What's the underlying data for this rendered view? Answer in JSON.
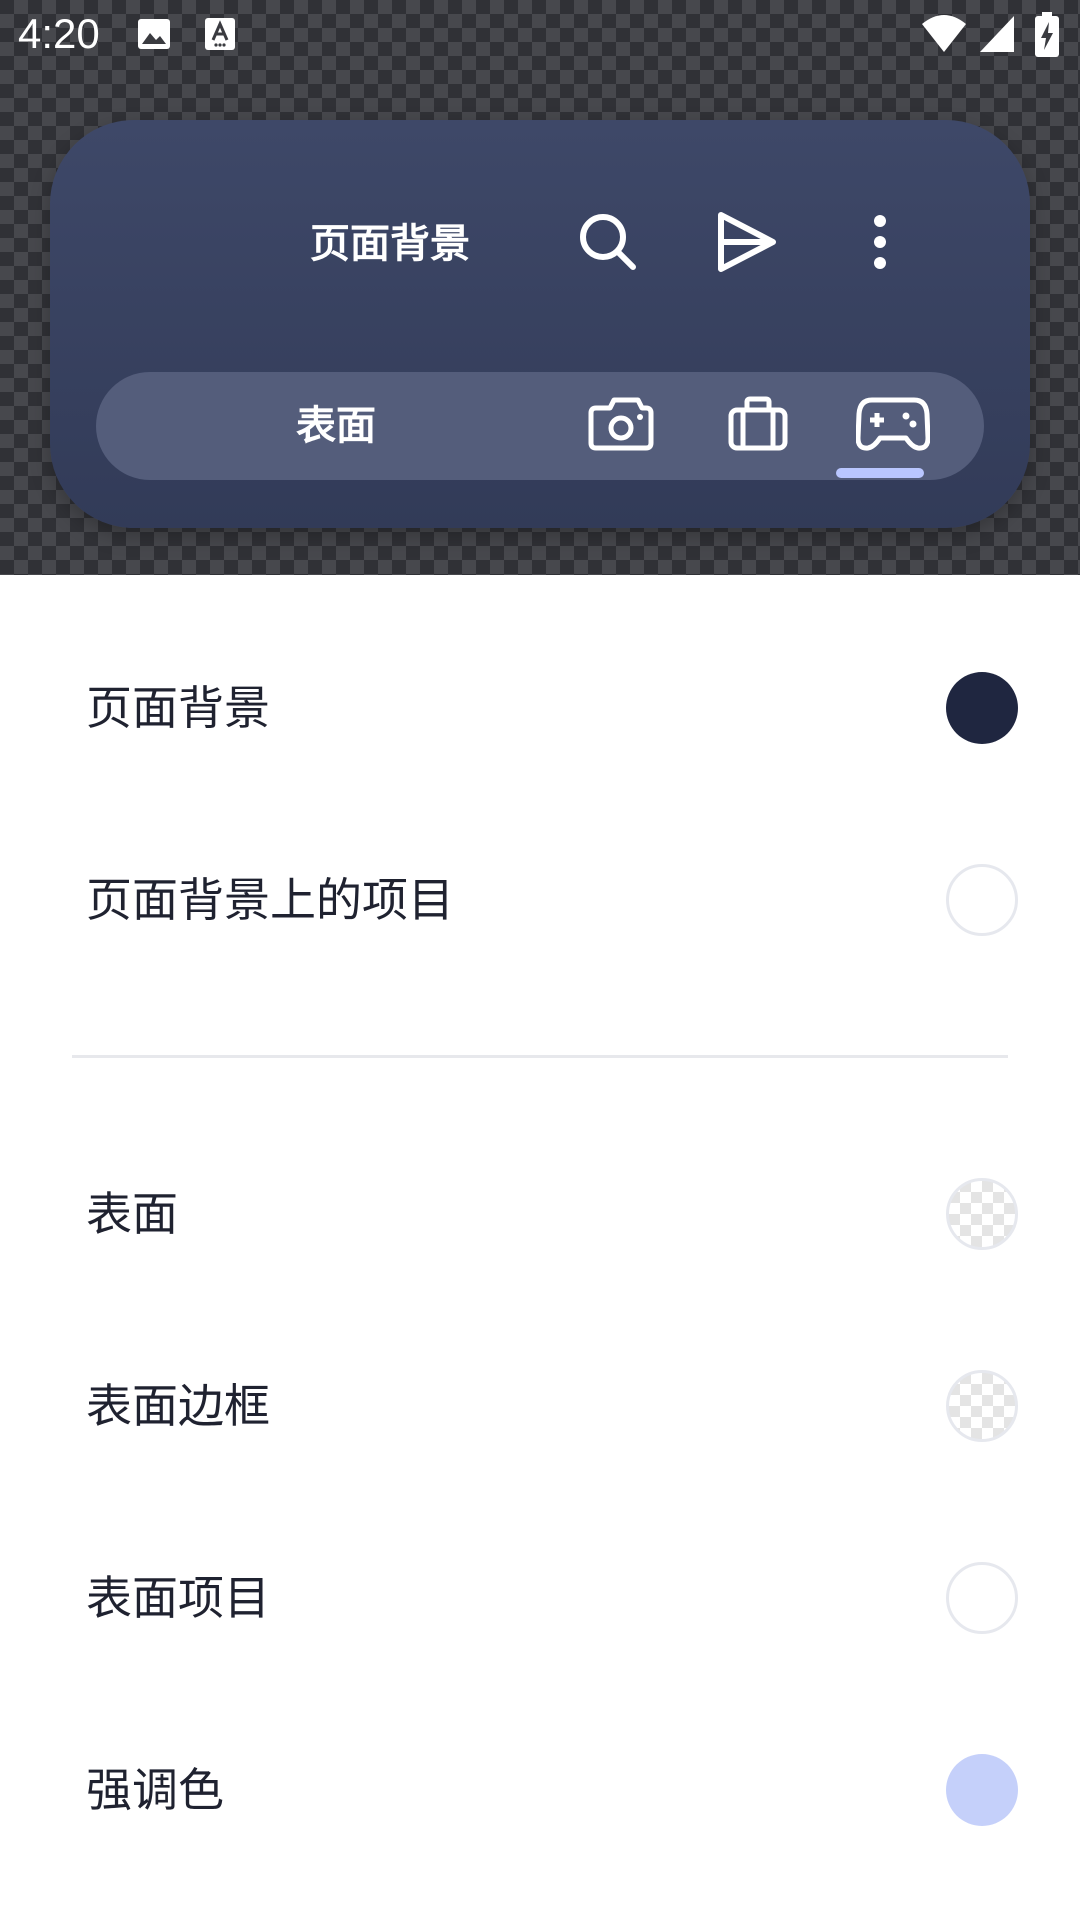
{
  "status_bar": {
    "time": "4:20",
    "icons": [
      "image-notification-icon",
      "font-notification-icon",
      "wifi-icon",
      "signal-icon",
      "battery-charging-icon"
    ]
  },
  "widget": {
    "title": "页面背景",
    "actions": [
      "search-icon",
      "send-icon",
      "more-vertical-icon"
    ],
    "tab_label": "表面",
    "tabs": [
      "camera-icon",
      "briefcase-icon",
      "gamepad-icon"
    ],
    "selected_tab": "gamepad-icon",
    "card_color": "#3a4464",
    "tab_bar_color": "#545d7b",
    "indicator_color": "#b9c6ff"
  },
  "color_list": {
    "items": [
      {
        "label": "页面背景",
        "swatch": "#1f2640",
        "style": "filled"
      },
      {
        "label": "页面背景上的项目",
        "swatch": "#ffffff",
        "style": "outline"
      },
      {
        "label": "表面",
        "swatch": "transparent",
        "style": "checker"
      },
      {
        "label": "表面边框",
        "swatch": "transparent",
        "style": "checker"
      },
      {
        "label": "表面项目",
        "swatch": "#ffffff",
        "style": "outline"
      },
      {
        "label": "强调色",
        "swatch": "#c5d0fa",
        "style": "filled"
      }
    ]
  }
}
